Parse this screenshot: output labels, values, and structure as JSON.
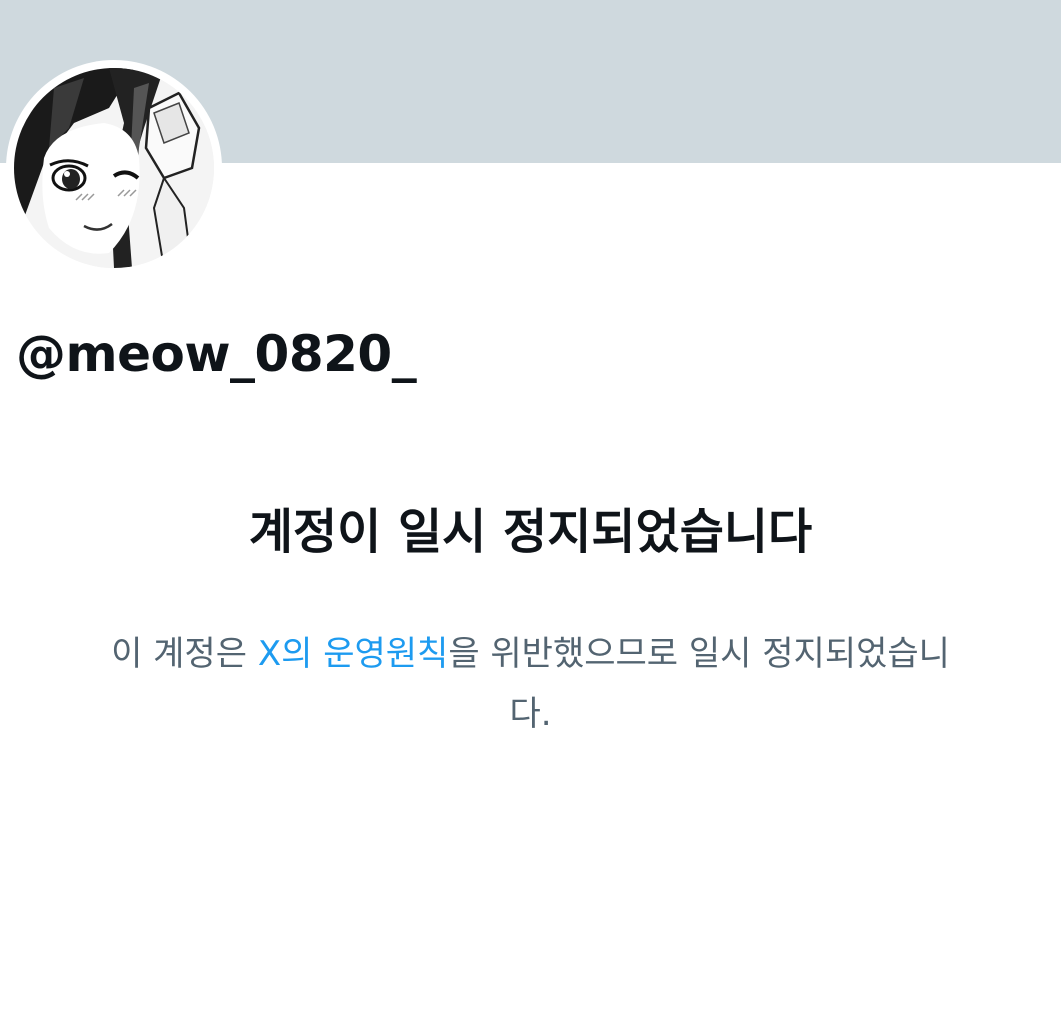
{
  "profile": {
    "handle": "@meow_0820_",
    "avatar": "manga-girl-winking-avatar"
  },
  "suspension": {
    "title": "계정이 일시 정지되었습니다",
    "body_before": "이 계정은 ",
    "rules_link": "X의 운영원칙",
    "body_after": "을 위반했으므로 일시 정지되었습니다."
  },
  "colors": {
    "banner": "#cfd9de",
    "text_primary": "#0f1419",
    "text_secondary": "#536471",
    "link": "#1d9bf0"
  }
}
